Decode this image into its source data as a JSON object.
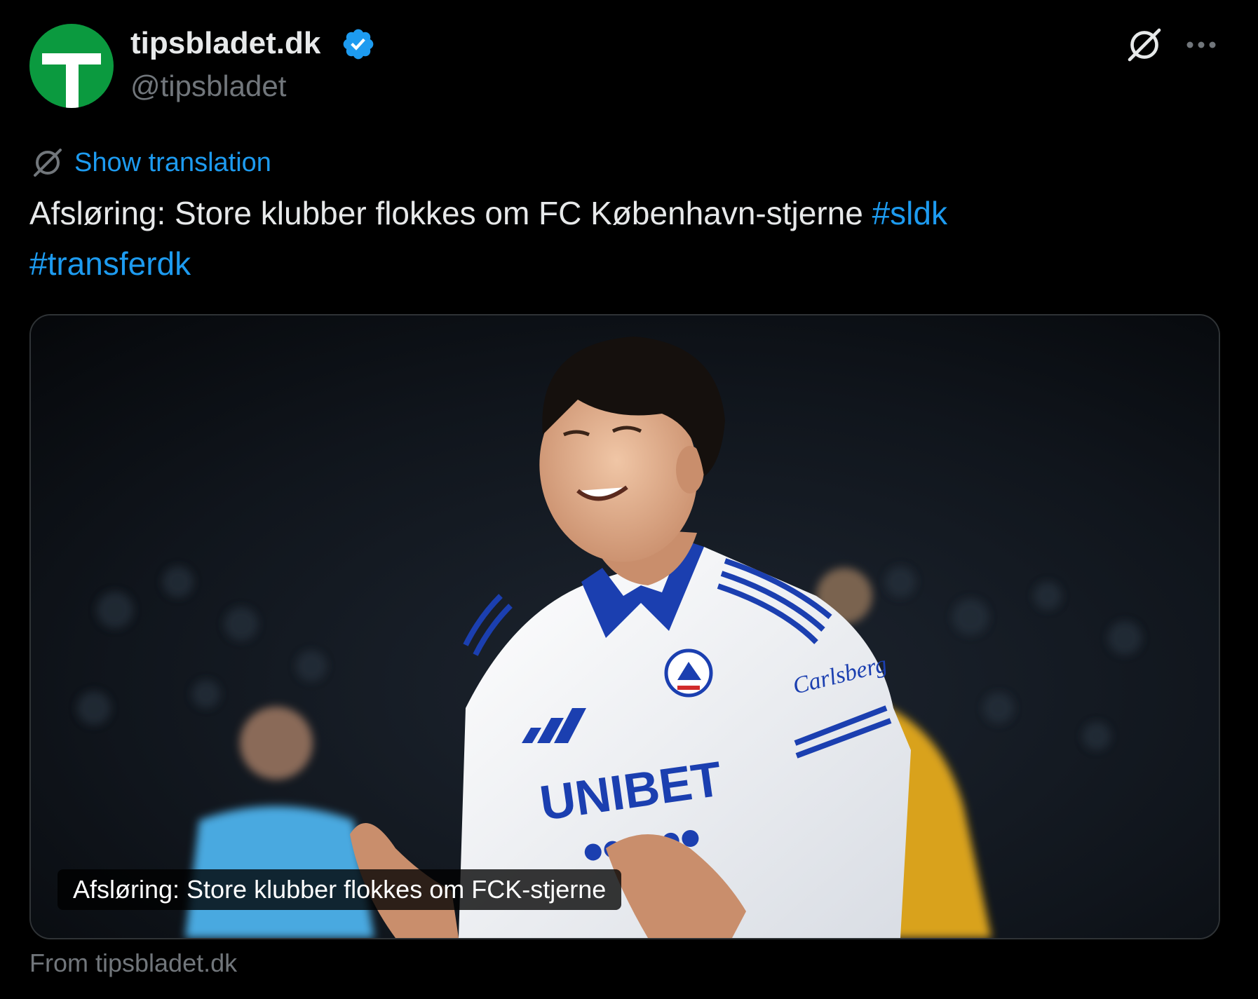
{
  "author": {
    "name": "tipsbladet.dk",
    "handle": "@tipsbladet",
    "verified": true,
    "avatar_color": "#0b9a3f"
  },
  "actions": {
    "grok_icon": "grok-icon",
    "more_icon": "more-icon"
  },
  "translate": {
    "icon": "translate-icon",
    "label": "Show translation"
  },
  "tweet": {
    "text": "Afsløring: Store klubber flokkes om FC København-stjerne",
    "hashtags": [
      "#sldk",
      "#transferdk"
    ]
  },
  "card": {
    "caption": "Afsløring: Store klubber flokkes om FCK-stjerne",
    "shirt_sponsor": "UNIBET",
    "sleeve_sponsor": "Carlsberg"
  },
  "source": "From tipsbladet.dk",
  "colors": {
    "background": "#000000",
    "text": "#e7e9ea",
    "muted": "#71767b",
    "link": "#1d9bf0",
    "verified": "#1d9bf0"
  }
}
